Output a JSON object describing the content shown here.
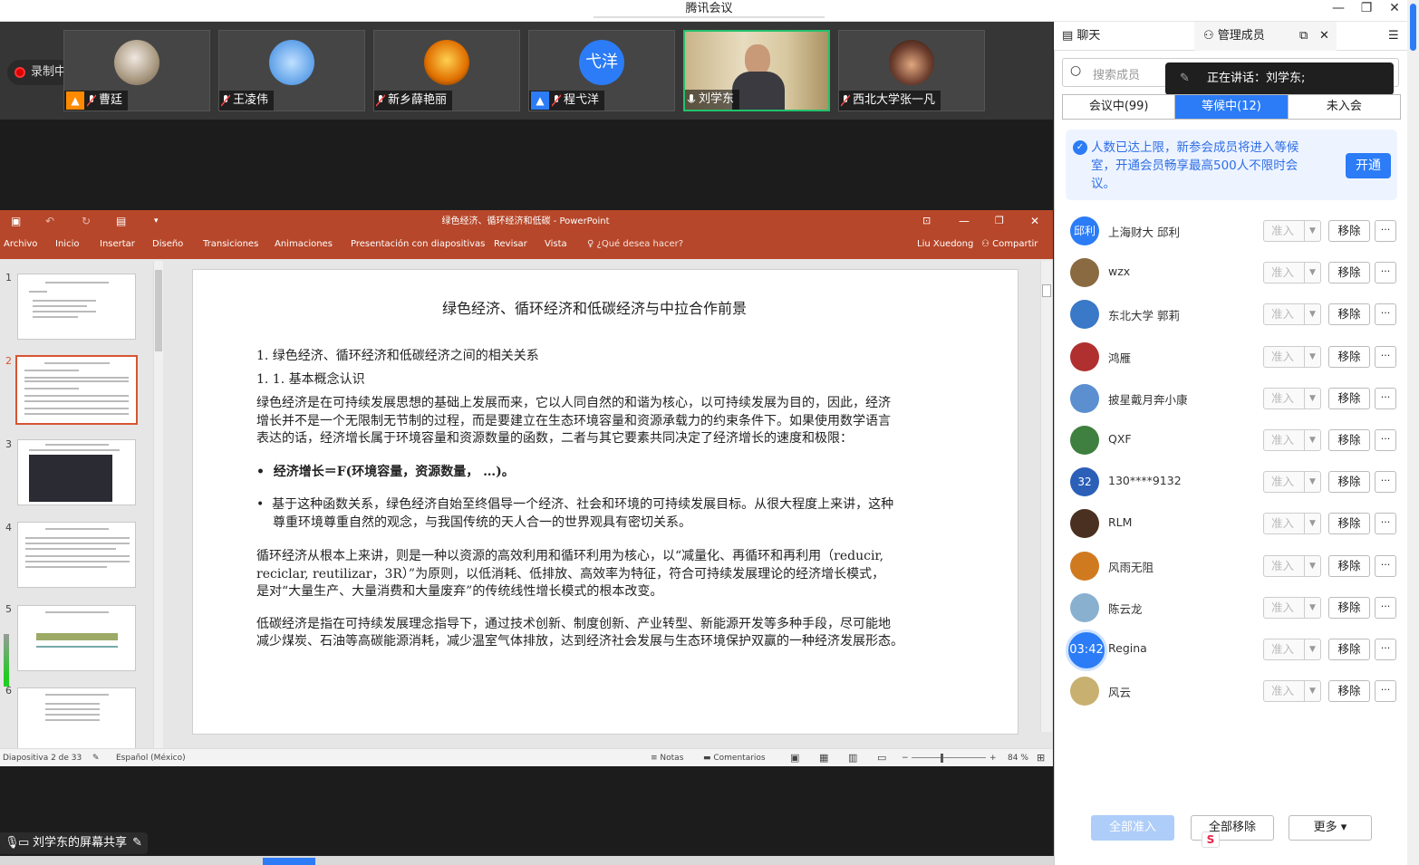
{
  "window": {
    "title": "腾讯会议"
  },
  "recording": {
    "label": "录制中"
  },
  "video_tiles": [
    {
      "name": "曹廷"
    },
    {
      "name": "王凌伟"
    },
    {
      "name": "新乡薛艳丽"
    },
    {
      "name": "程弋洋",
      "avatar_text": "弋洋"
    },
    {
      "name": "刘学东"
    },
    {
      "name": "西北大学张一凡"
    }
  ],
  "ppt": {
    "doc_title": "绿色经济、循环经济和低碳 - PowerPoint",
    "tabs": [
      "Archivo",
      "Inicio",
      "Insertar",
      "Diseño",
      "Transiciones",
      "Animaciones",
      "Presentación con diapositivas",
      "Revisar",
      "Vista"
    ],
    "tell_me": "¿Qué desea hacer?",
    "user": "Liu Xuedong",
    "share": "Compartir",
    "thumb_numbers": [
      "1",
      "2",
      "3",
      "4",
      "5",
      "6"
    ],
    "status": {
      "slide_info": "Diapositiva 2 de 33",
      "language": "Español (México)",
      "notes": "Notas",
      "comments": "Comentarios",
      "zoom": "84 %"
    },
    "slide": {
      "title": "绿色经济、循环经济和低碳经济与中拉合作前景",
      "h1": "1. 绿色经济、循环经济和低碳经济之间的相关关系",
      "h2": "1. 1.  基本概念认识",
      "p1": [
        "绿色经济是在可持续发展思想的基础上发展而来，它以人同自然的和谐为核心，以可持续发展为目的，因此，经济",
        "增长并不是一个无限制无节制的过程，而是要建立在生态环境容量和资源承载力的约束条件下。如果使用数学语言",
        "表达的话，经济增长属于环境容量和资源数量的函数，二者与其它要素共同决定了经济增长的速度和极限："
      ],
      "b1": "经济增长＝F(环境容量，资源数量， …)。",
      "b2": [
        "基于这种函数关系，绿色经济自始至终倡导一个经济、社会和环境的可持续发展目标。从很大程度上来讲，这种",
        "尊重环境尊重自然的观念，与我国传统的天人合一的世界观具有密切关系。"
      ],
      "p2": [
        "循环经济从根本上来讲，则是一种以资源的高效利用和循环利用为核心，以“减量化、再循环和再利用（reducir,",
        "reciclar, reutilizar，3R）”为原则，以低消耗、低排放、高效率为特征，符合可持续发展理论的经济增长模式，",
        "是对“大量生产、大量消费和大量废弃”的传统线性增长模式的根本改变。"
      ],
      "p3": [
        "低碳经济是指在可持续发展理念指导下，通过技术创新、制度创新、产业转型、新能源开发等多种手段，尽可能地",
        "减少煤炭、石油等高碳能源消耗，减少温室气体排放，达到经济社会发展与生态环境保护双赢的一种经济发展形态。"
      ]
    }
  },
  "screen_share_label": "刘学东的屏幕共享",
  "panel": {
    "chat_tab": "聊天",
    "members_tab": "管理成员",
    "search_placeholder": "搜索成员",
    "speaking": "正在讲话：刘学东;",
    "segments": [
      "会议中(99)",
      "等候中(12)",
      "未入会"
    ],
    "notice": "人数已达上限，新参会成员将进入等候室，开通会员畅享最高500人不限时会议。",
    "open_label": "开通",
    "admit_label": "准入",
    "remove_label": "移除",
    "more_dots": "···",
    "timer": "03:42",
    "waiting": [
      {
        "name": "上海财大 邱利",
        "avatar_text": "邱利",
        "color": "#2b7cf6"
      },
      {
        "name": "wzx",
        "color": "#8a6a40"
      },
      {
        "name": "东北大学 郭莉",
        "color": "#3a78c8"
      },
      {
        "name": "鸿雁",
        "color": "#b03030"
      },
      {
        "name": "披星戴月奔小康",
        "color": "#5b8fd0"
      },
      {
        "name": "QXF",
        "color": "#3f7f3f"
      },
      {
        "name": "130****9132",
        "avatar_text": "32",
        "color": "#2b5fb8"
      },
      {
        "name": "RLM",
        "color": "#4a3020"
      },
      {
        "name": "风雨无阻",
        "color": "#d07a20"
      },
      {
        "name": "陈云龙",
        "color": "#8ab0d0"
      },
      {
        "name": "Regina",
        "color": "#b08a70"
      },
      {
        "name": "风云",
        "color": "#c8b070"
      }
    ],
    "admit_all": "全部准入",
    "remove_all": "全部移除",
    "more": "更多 ▾"
  }
}
